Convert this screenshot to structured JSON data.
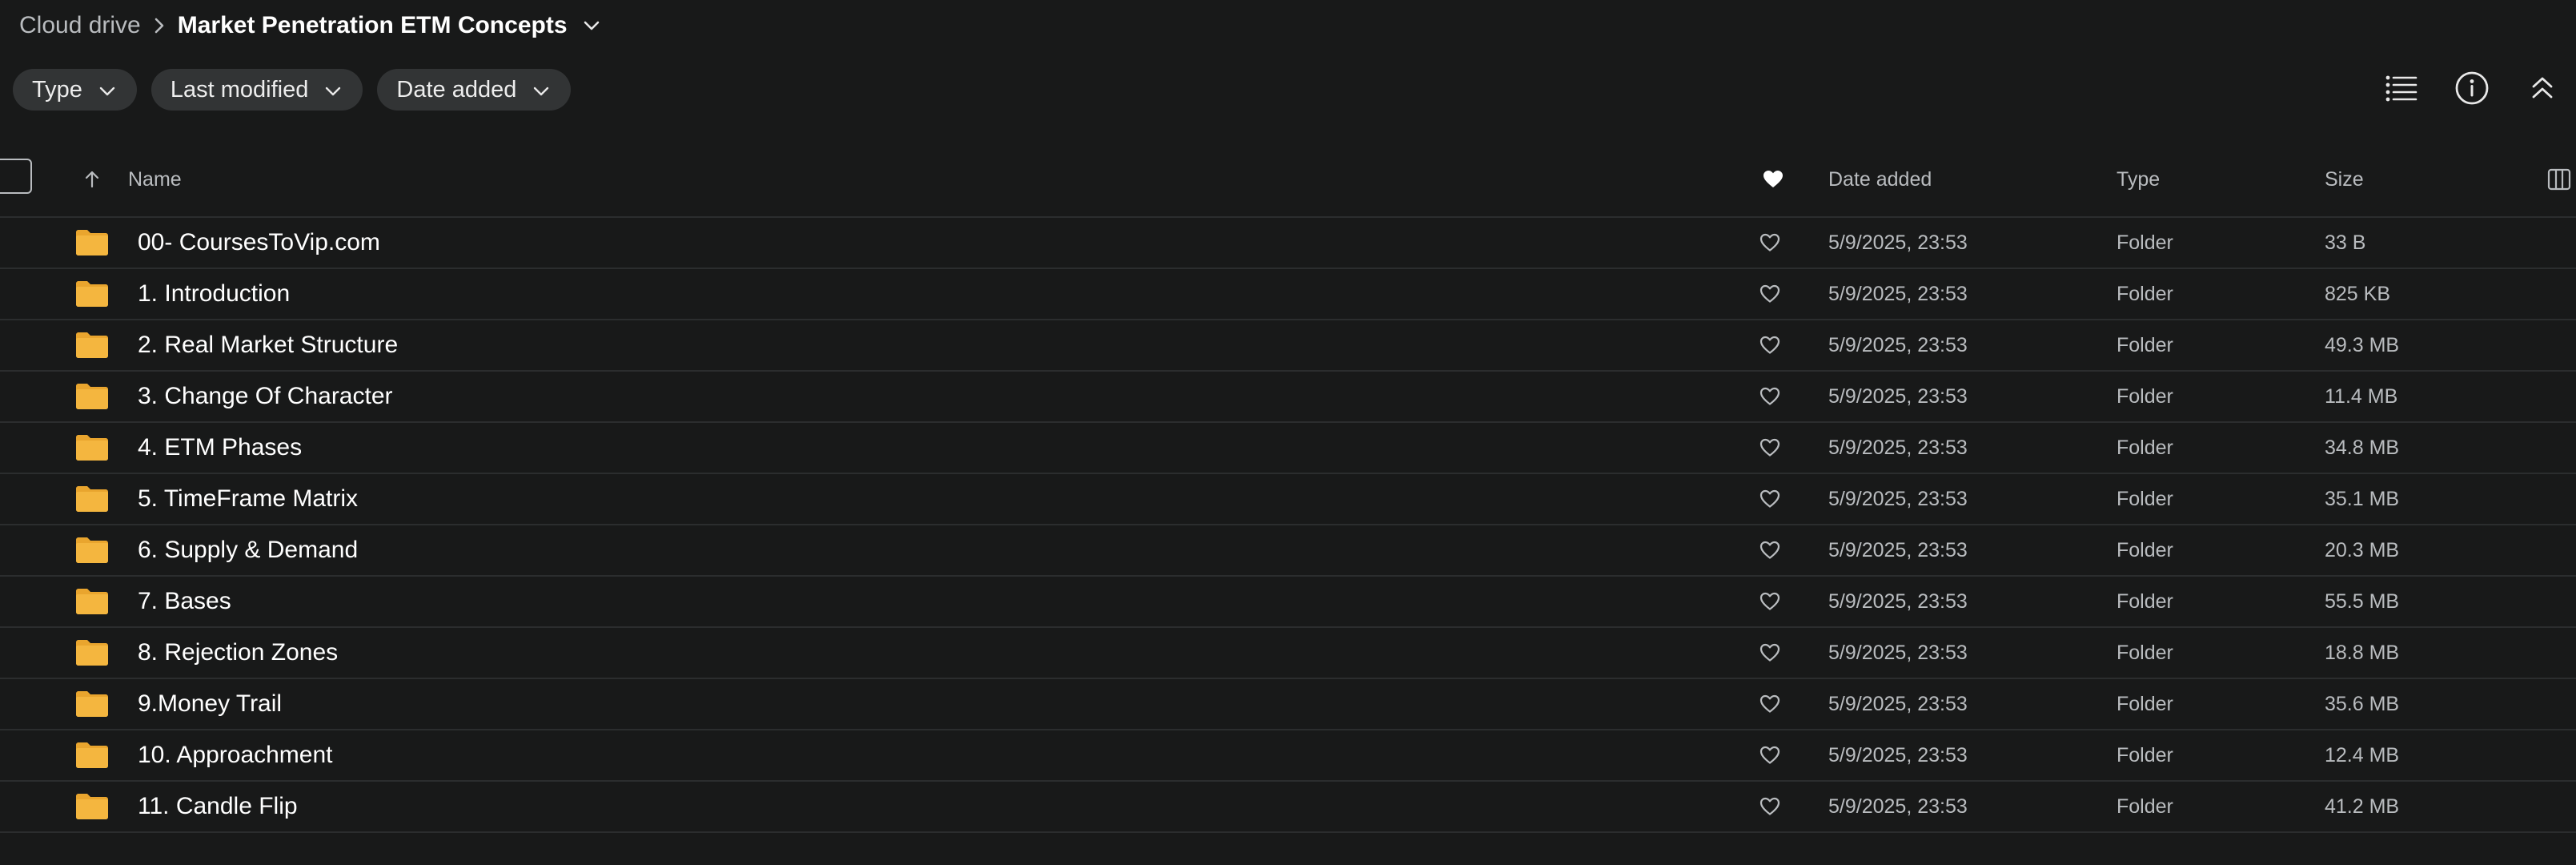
{
  "breadcrumb": {
    "root": "Cloud drive",
    "current": "Market Penetration ETM Concepts"
  },
  "filters": [
    {
      "label": "Type"
    },
    {
      "label": "Last modified"
    },
    {
      "label": "Date added"
    }
  ],
  "toolbar_icons": [
    "list-view-icon",
    "info-icon",
    "collapse-up-icon"
  ],
  "table": {
    "columns": {
      "name": "Name",
      "date_added": "Date added",
      "type": "Type",
      "size": "Size"
    },
    "sort": "name-ascending",
    "rows": [
      {
        "name": "00- CoursesToVip.com",
        "date": "5/9/2025, 23:53",
        "type": "Folder",
        "size": "33 B"
      },
      {
        "name": "1. Introduction",
        "date": "5/9/2025, 23:53",
        "type": "Folder",
        "size": "825 KB"
      },
      {
        "name": "2. Real Market Structure",
        "date": "5/9/2025, 23:53",
        "type": "Folder",
        "size": "49.3 MB"
      },
      {
        "name": "3. Change Of Character",
        "date": "5/9/2025, 23:53",
        "type": "Folder",
        "size": "11.4 MB"
      },
      {
        "name": "4. ETM Phases",
        "date": "5/9/2025, 23:53",
        "type": "Folder",
        "size": "34.8 MB"
      },
      {
        "name": "5. TimeFrame Matrix",
        "date": "5/9/2025, 23:53",
        "type": "Folder",
        "size": "35.1 MB"
      },
      {
        "name": "6. Supply & Demand",
        "date": "5/9/2025, 23:53",
        "type": "Folder",
        "size": "20.3 MB"
      },
      {
        "name": "7. Bases",
        "date": "5/9/2025, 23:53",
        "type": "Folder",
        "size": "55.5 MB"
      },
      {
        "name": "8. Rejection Zones",
        "date": "5/9/2025, 23:53",
        "type": "Folder",
        "size": "18.8 MB"
      },
      {
        "name": "9.Money Trail",
        "date": "5/9/2025, 23:53",
        "type": "Folder",
        "size": "35.6 MB"
      },
      {
        "name": "10. Approachment",
        "date": "5/9/2025, 23:53",
        "type": "Folder",
        "size": "12.4 MB"
      },
      {
        "name": "11. Candle Flip",
        "date": "5/9/2025, 23:53",
        "type": "Folder",
        "size": "41.2 MB"
      }
    ]
  },
  "colors": {
    "background": "#181919",
    "chip": "#323435",
    "folder": "#f4b63f",
    "divider": "#2b2d2e"
  }
}
